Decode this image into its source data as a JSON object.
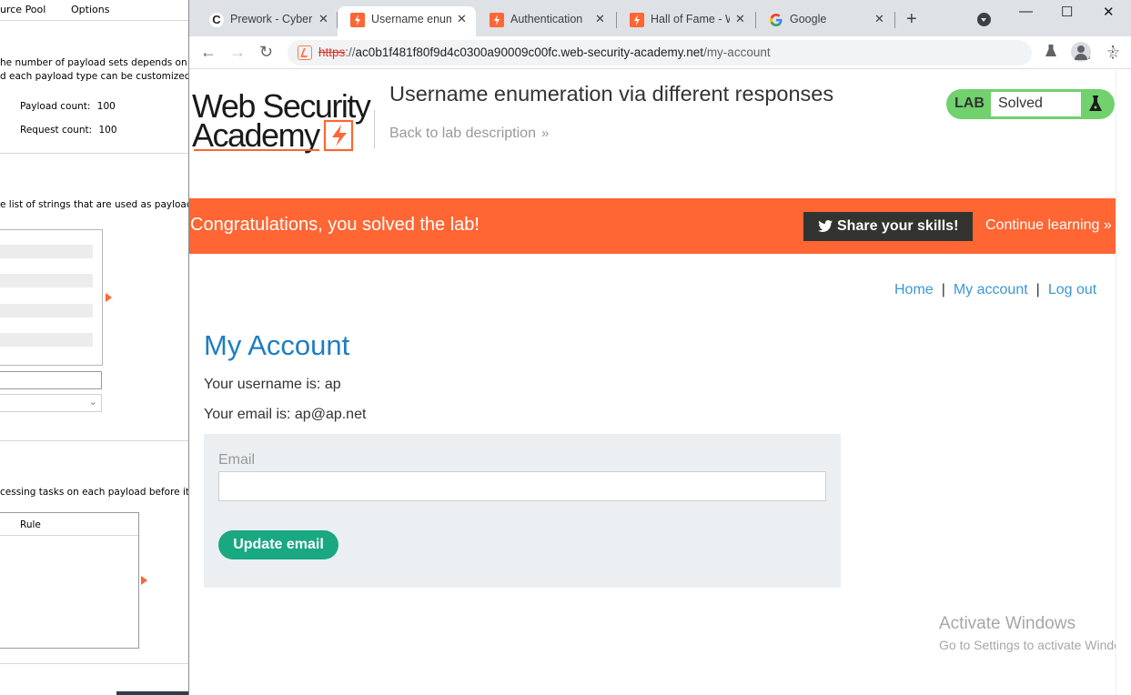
{
  "background_app": {
    "tabs": [
      "urce Pool",
      "Options"
    ],
    "payload_sets_text_1": "he number of payload sets depends on t",
    "payload_sets_text_2": "d each payload type can be customized ir",
    "payload_count_label": "Payload count:",
    "payload_count_value": "100",
    "request_count_label": "Request count:",
    "request_count_value": "100",
    "payload_options_text": "e list of strings that are used as payload",
    "processing_text": "cessing tasks on each payload before it i",
    "rule_column_header": "Rule"
  },
  "browser": {
    "tabs": [
      {
        "title": "Prework - Cybers",
        "icon": "c-logo-icon"
      },
      {
        "title": "Username enum",
        "icon": "bolt-icon",
        "active": true
      },
      {
        "title": "Authentication la",
        "icon": "bolt-icon"
      },
      {
        "title": "Hall of Fame - W",
        "icon": "bolt-icon"
      },
      {
        "title": "Google",
        "icon": "google-icon"
      }
    ],
    "new_tab": "+",
    "window_controls": {
      "minimize": "—",
      "maximize": "☐",
      "close": "✕"
    },
    "url": {
      "scheme": "https",
      "separator": "://",
      "host": "ac0b1f481f80f9d4c0300a90009c00fc.web-security-academy.net",
      "path": "/my-account"
    }
  },
  "page": {
    "logo_text_1": "Web Security",
    "logo_text_2": "Academy",
    "title": "Username enumeration via different responses",
    "back_link": "Back to lab description",
    "lab_label": "LAB",
    "lab_status": "Solved",
    "banner": {
      "message": "Congratulations, you solved the lab!",
      "share_label": "Share your skills!",
      "continue_label": "Continue learning"
    },
    "nav": {
      "home": "Home",
      "separator": "|",
      "my_account": "My account",
      "log_out": "Log out"
    },
    "heading": "My Account",
    "username_text": "Your username is: ap",
    "email_text": "Your email is: ap@ap.net",
    "form": {
      "email_label": "Email",
      "email_value": "",
      "update_button": "Update email"
    },
    "colors": {
      "accent_orange": "#ff6633",
      "link_blue": "#3b97d3",
      "heading_blue": "#1f7dc2",
      "button_green": "#19a882",
      "lab_badge_green": "#70d16d"
    }
  },
  "watermark": {
    "title": "Activate Windows",
    "subtitle": "Go to Settings to activate Windows."
  }
}
